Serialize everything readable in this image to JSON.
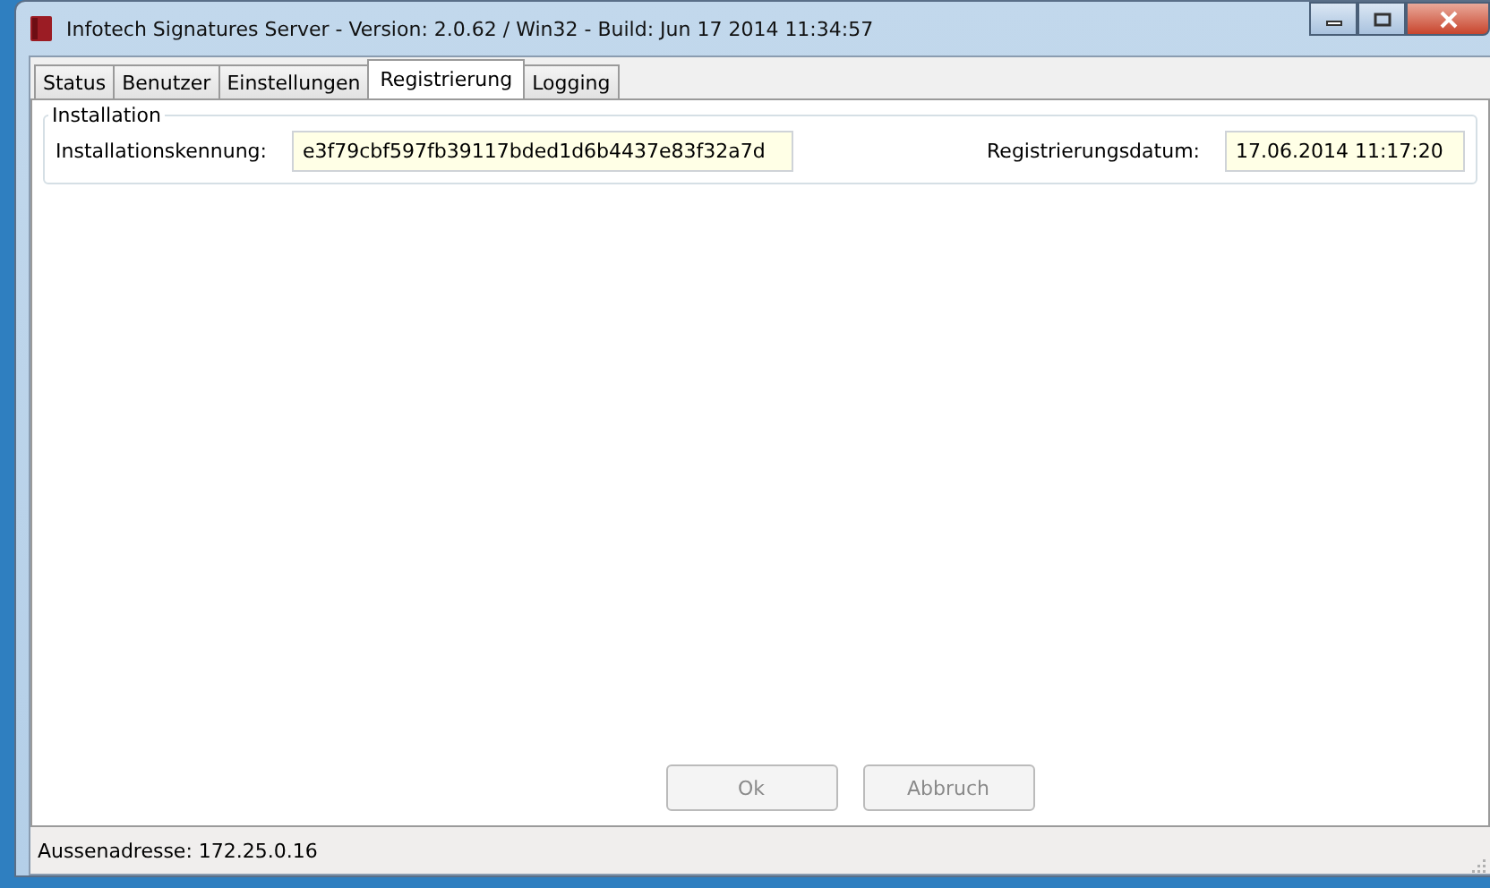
{
  "window": {
    "title": "Infotech Signatures Server - Version: 2.0.62 / Win32 - Build: Jun 17 2014 11:34:57"
  },
  "tabs": [
    {
      "label": "Status",
      "selected": false
    },
    {
      "label": "Benutzer",
      "selected": false
    },
    {
      "label": "Einstellungen",
      "selected": false
    },
    {
      "label": "Registrierung",
      "selected": true
    },
    {
      "label": "Logging",
      "selected": false
    }
  ],
  "group": {
    "title": "Installation",
    "fields": [
      {
        "label": "Installationskennung:",
        "value": "e3f79cbf597fb39117bded1d6b4437e83f32a7d"
      },
      {
        "label": "Registrierungsdatum:",
        "value": "17.06.2014 11:17:20"
      }
    ]
  },
  "buttons": [
    {
      "label": "Ok",
      "disabled": true
    },
    {
      "label": "Abbruch",
      "disabled": true
    }
  ],
  "status_bar": {
    "text": "Aussenadresse: 172.25.0.16"
  }
}
